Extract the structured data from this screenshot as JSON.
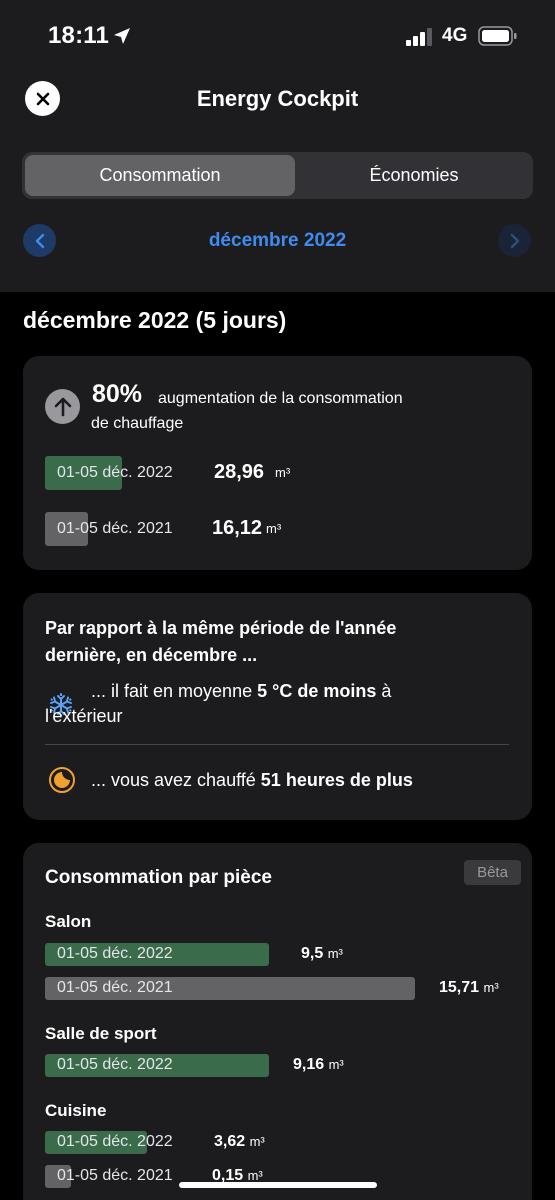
{
  "status_bar": {
    "time": "18:11",
    "network": "4G"
  },
  "header": {
    "title": "Energy Cockpit"
  },
  "tabs": [
    {
      "label": "Consommation",
      "active": true
    },
    {
      "label": "Économies",
      "active": false
    }
  ],
  "month_nav": {
    "label": "décembre 2022"
  },
  "period_title": "décembre 2022 (5 jours)",
  "summary": {
    "percent": "80%",
    "description_line1": "augmentation de la consommation",
    "description_line2": "de chauffage",
    "rows": [
      {
        "label": "01-05 déc. 2022",
        "value": "28,96",
        "unit": "m³",
        "fill_fraction": 1.0
      },
      {
        "label": "01-05 déc. 2021",
        "value": "16,12",
        "unit": "m³",
        "fill_fraction": 0.556
      }
    ]
  },
  "comparison": {
    "heading_line1": "Par rapport à la même période de l'année",
    "heading_line2": "dernière, en décembre ...",
    "temp_prefix": "... il fait en moyenne",
    "temp_bold": "5 °C de moins",
    "temp_suffix": "à",
    "temp_line2": "l'extérieur",
    "hours_prefix": "... vous avez chauffé",
    "hours_bold": "51 heures de plus"
  },
  "rooms": {
    "heading": "Consommation par pièce",
    "badge": "Bêta",
    "items": [
      {
        "name": "Salon",
        "rows": [
          {
            "label": "01-05 déc. 2022",
            "value": "9,5",
            "unit": "m³",
            "fill_fraction": 0.605
          },
          {
            "label": "01-05 déc. 2021",
            "value": "15,71",
            "unit": "m³",
            "fill_fraction": 1.0
          }
        ]
      },
      {
        "name": "Salle de sport",
        "rows": [
          {
            "label": "01-05 déc. 2022",
            "value": "9,16",
            "unit": "m³",
            "fill_fraction": 0.583
          }
        ]
      },
      {
        "name": "Cuisine",
        "rows": [
          {
            "label": "01-05 déc. 2022",
            "value": "3,62",
            "unit": "m³",
            "fill_fraction": 0.23
          },
          {
            "label": "01-05 déc. 2021",
            "value": "0,15",
            "unit": "m³",
            "fill_fraction": 0.07
          }
        ]
      }
    ]
  },
  "colors": {
    "accent_blue": "#3f8bf0",
    "bar_current": "#3a6b4a",
    "bar_previous": "#636366"
  },
  "icons": [
    "location-arrow-icon",
    "signal-icon",
    "battery-icon",
    "close-icon",
    "chevron-left-icon",
    "chevron-right-icon",
    "arrow-up-icon",
    "snowflake-icon",
    "moon-icon"
  ]
}
